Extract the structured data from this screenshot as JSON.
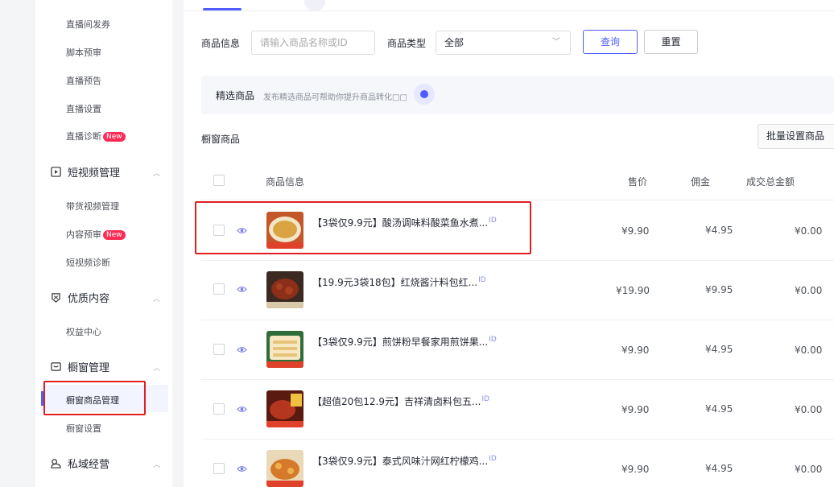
{
  "sidebar": {
    "items_top": [
      {
        "label": "直播间发券"
      },
      {
        "label": "脚本预审"
      },
      {
        "label": "直播预告"
      },
      {
        "label": "直播设置"
      },
      {
        "label": "直播诊断",
        "badge": "New"
      }
    ],
    "groups": [
      {
        "label": "短视频管理",
        "icon": "video-icon",
        "items": [
          {
            "label": "带货视频管理"
          },
          {
            "label": "内容预审",
            "badge": "New"
          },
          {
            "label": "短视频诊断"
          }
        ]
      },
      {
        "label": "优质内容",
        "icon": "quality-content-icon",
        "items": [
          {
            "label": "权益中心"
          }
        ]
      },
      {
        "label": "橱窗管理",
        "icon": "showcase-icon",
        "items": [
          {
            "label": "橱窗商品管理",
            "active": true
          },
          {
            "label": "橱窗设置"
          }
        ]
      },
      {
        "label": "私域经营",
        "icon": "private-domain-icon",
        "items": []
      }
    ]
  },
  "filters": {
    "product_info_label": "商品信息",
    "search_placeholder": "请输入商品名称或ID",
    "product_type_label": "商品类型",
    "product_type_value": "全部",
    "query_label": "查询",
    "reset_label": "重置"
  },
  "banner": {
    "title": "精选商品",
    "subtitle": "发布精选商品可帮助你提升商品转化□□"
  },
  "section": {
    "title": "橱窗商品",
    "batch_button": "批量设置商品"
  },
  "table": {
    "columns": [
      "商品信息",
      "售价",
      "佣金",
      "成交总金额"
    ],
    "id_tag": "ID",
    "rows": [
      {
        "name": "【3袋仅9.9元】酸汤调味料酸菜鱼水煮...",
        "price": "¥9.90",
        "commission": "¥4.95",
        "total": "¥0.00",
        "thumb_color": "#d9a441"
      },
      {
        "name": "【19.9元3袋18包】红烧酱汁料包红...",
        "price": "¥19.90",
        "commission": "¥9.95",
        "total": "¥0.00",
        "thumb_color": "#8b2e1a"
      },
      {
        "name": "【3袋仅9.9元】煎饼粉早餐家用煎饼果...",
        "price": "¥9.90",
        "commission": "¥4.95",
        "total": "¥0.00",
        "thumb_color": "#e8c37a"
      },
      {
        "name": "【超值20包12.9元】吉祥清卤料包五...",
        "price": "¥9.90",
        "commission": "¥4.95",
        "total": "¥0.00",
        "thumb_color": "#b5361f"
      },
      {
        "name": "【3袋仅9.9元】泰式风味汁网红柠檬鸡...",
        "price": "¥9.90",
        "commission": "¥4.95",
        "total": "¥0.00",
        "thumb_color": "#d47a2a"
      }
    ]
  }
}
